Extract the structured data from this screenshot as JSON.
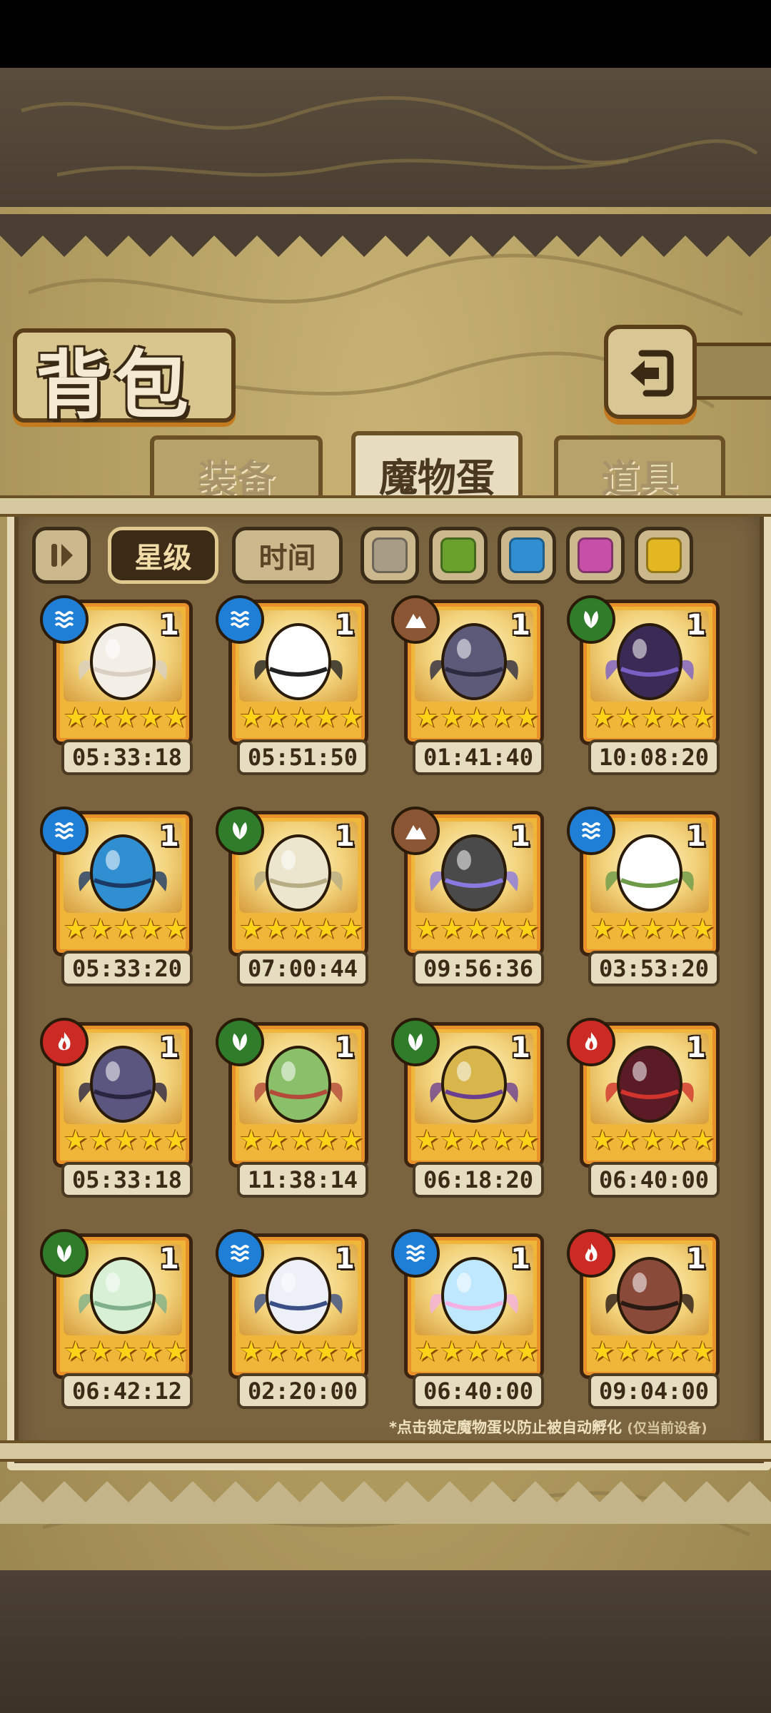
{
  "header": {
    "title": "背包"
  },
  "tabs": [
    {
      "label": "装备",
      "active": false
    },
    {
      "label": "魔物蛋",
      "active": true
    },
    {
      "label": "道具",
      "active": false
    }
  ],
  "filters": {
    "sort_options": [
      {
        "label": "星级",
        "selected": true
      },
      {
        "label": "时间",
        "selected": false
      }
    ],
    "color_swatches": [
      "#a89c86",
      "#6aa12c",
      "#2f8fd1",
      "#c84fa8",
      "#e3b722"
    ]
  },
  "elements": {
    "water": {
      "name": "water-icon",
      "color": "#1f7fd6"
    },
    "nature": {
      "name": "leaf-icon",
      "color": "#2f7d2a"
    },
    "earth": {
      "name": "mountain-icon",
      "color": "#8a5634"
    },
    "fire": {
      "name": "flame-icon",
      "color": "#cc2a25"
    }
  },
  "eggs": [
    {
      "element": "water",
      "count": "1",
      "stars": 5,
      "timer": "05:33:18",
      "art": "angel-egg"
    },
    {
      "element": "water",
      "count": "1",
      "stars": 5,
      "timer": "05:51:50",
      "art": "panda-egg"
    },
    {
      "element": "earth",
      "count": "1",
      "stars": 5,
      "timer": "01:41:40",
      "art": "helmet-egg"
    },
    {
      "element": "nature",
      "count": "1",
      "stars": 5,
      "timer": "10:08:20",
      "art": "crystal-egg"
    },
    {
      "element": "water",
      "count": "1",
      "stars": 5,
      "timer": "05:33:20",
      "art": "sword-egg"
    },
    {
      "element": "nature",
      "count": "1",
      "stars": 5,
      "timer": "07:00:44",
      "art": "bulb-egg"
    },
    {
      "element": "earth",
      "count": "1",
      "stars": 5,
      "timer": "09:56:36",
      "art": "rock-egg"
    },
    {
      "element": "water",
      "count": "1",
      "stars": 5,
      "timer": "03:53:20",
      "art": "vine-egg"
    },
    {
      "element": "fire",
      "count": "1",
      "stars": 5,
      "timer": "05:33:18",
      "art": "bat-egg"
    },
    {
      "element": "nature",
      "count": "1",
      "stars": 5,
      "timer": "11:38:14",
      "art": "green-egg"
    },
    {
      "element": "nature",
      "count": "1",
      "stars": 5,
      "timer": "06:18:20",
      "art": "lamp-egg"
    },
    {
      "element": "fire",
      "count": "1",
      "stars": 5,
      "timer": "06:40:00",
      "art": "demon-egg"
    },
    {
      "element": "nature",
      "count": "1",
      "stars": 5,
      "timer": "06:42:12",
      "art": "mint-egg"
    },
    {
      "element": "water",
      "count": "1",
      "stars": 5,
      "timer": "02:20:00",
      "art": "feather-egg"
    },
    {
      "element": "water",
      "count": "1",
      "stars": 5,
      "timer": "06:40:00",
      "art": "rainbow-egg"
    },
    {
      "element": "fire",
      "count": "1",
      "stars": 5,
      "timer": "09:04:00",
      "art": "lava-egg"
    }
  ],
  "footer": {
    "note": "*点击锁定魔物蛋以防止被自动孵化",
    "note_sub": "(仅当前设备)"
  }
}
